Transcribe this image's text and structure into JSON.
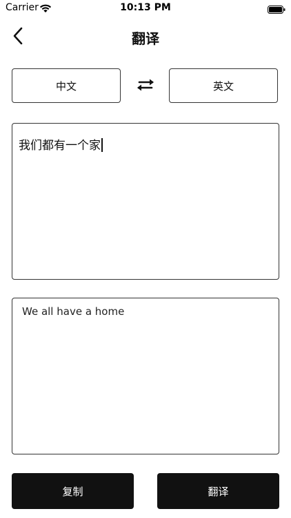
{
  "status_bar": {
    "carrier": "Carrier",
    "time": "10:13 PM",
    "wifi_icon": "wifi-icon",
    "battery_icon": "battery-icon"
  },
  "nav": {
    "title": "翻译",
    "back_icon": "chevron-left-icon"
  },
  "languages": {
    "source": "中文",
    "target": "英文",
    "swap_icon": "swap-arrows-icon"
  },
  "input": {
    "value": "我们都有一个家"
  },
  "output": {
    "value": "We all have a home"
  },
  "actions": {
    "copy_label": "复制",
    "translate_label": "翻译"
  },
  "colors": {
    "button_background": "#111111",
    "button_text": "#ffffff",
    "border": "#333333"
  }
}
